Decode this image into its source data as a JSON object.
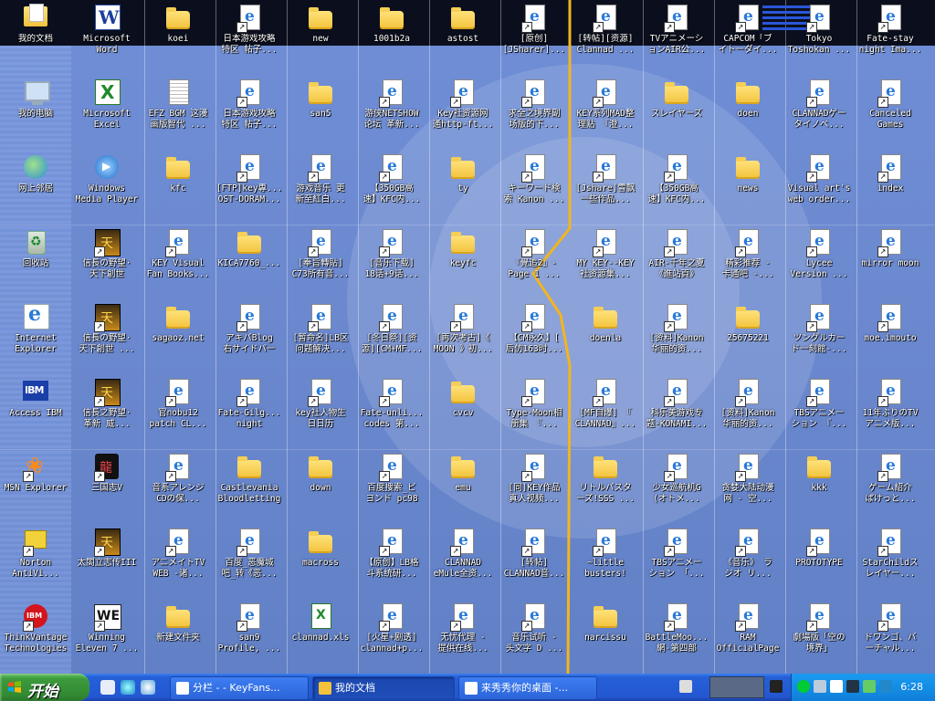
{
  "colors": {
    "desktop": "#6c89cf",
    "taskbar": "#2457d2",
    "start": "#3c9a3c"
  },
  "icons": [
    {
      "label": "我的文档",
      "icon": "my-documents-icon",
      "shape": "mydocs"
    },
    {
      "label": "我的电脑",
      "icon": "my-computer-icon",
      "shape": "pc"
    },
    {
      "label": "网上邻居",
      "icon": "network-places-icon",
      "shape": "net"
    },
    {
      "label": "回收站",
      "icon": "recycle-bin-icon",
      "shape": "bin"
    },
    {
      "label": "Internet\nExplorer",
      "icon": "internet-explorer-icon",
      "shape": "ie"
    },
    {
      "label": "Access IBM",
      "icon": "ibm-icon",
      "shape": "ibm"
    },
    {
      "label": "MSN Explorer",
      "icon": "msn-butterfly-icon",
      "shape": "msn"
    },
    {
      "label": "Norton\nAntiVi...",
      "icon": "norton-icon",
      "shape": "norton"
    },
    {
      "label": "ThinkVantage\nTechnologies",
      "icon": "thinkvantage-icon",
      "shape": "tvt"
    },
    {
      "label": "Microsoft\nWord",
      "icon": "word-icon",
      "shape": "word"
    },
    {
      "label": "Microsoft\nExcel",
      "icon": "excel-icon",
      "shape": "excel"
    },
    {
      "label": "Windows\nMedia Player",
      "icon": "media-player-icon",
      "shape": "wmp"
    },
    {
      "label": "信長の野望·\n天下創世",
      "icon": "game-icon",
      "shape": "game"
    },
    {
      "label": "信長の野望·\n天下創世 ...",
      "icon": "game-icon",
      "shape": "game"
    },
    {
      "label": "信長之野望·\n革新 威...",
      "icon": "game-icon",
      "shape": "game"
    },
    {
      "label": "三国志V",
      "icon": "dragon-icon",
      "shape": "dragon"
    },
    {
      "label": "太閤立志传III",
      "icon": "game-icon",
      "shape": "game"
    },
    {
      "label": "Winning\nEleven 7 ...",
      "icon": "we-icon",
      "shape": "we"
    },
    {
      "label": "koei",
      "icon": "folder-icon",
      "shape": "folder"
    },
    {
      "label": "EFZ BGM 这漫\n画版智代 ...",
      "icon": "document-icon",
      "shape": "doc"
    },
    {
      "label": "kfc",
      "icon": "folder-icon",
      "shape": "folder"
    },
    {
      "label": "KEY Visual\nFan Books...",
      "icon": "web-shortcut-icon",
      "shape": "url"
    },
    {
      "label": "sagaoz.net",
      "icon": "folder-icon",
      "shape": "folder"
    },
    {
      "label": "官nobu12\npatch CL...",
      "icon": "web-shortcut-icon",
      "shape": "url"
    },
    {
      "label": "音系アレンジ\nCDの保...",
      "icon": "web-shortcut-icon",
      "shape": "url"
    },
    {
      "label": "アニメイトTV\nWEB -诸...",
      "icon": "web-shortcut-icon",
      "shape": "url"
    },
    {
      "label": "新建文件夹",
      "icon": "folder-icon",
      "shape": "folder"
    },
    {
      "label": "日本游戏攻略\n特区 帖子...",
      "icon": "web-shortcut-icon",
      "shape": "url"
    },
    {
      "label": "日本游戏攻略\n特区 帖子...",
      "icon": "web-shortcut-icon",
      "shape": "url"
    },
    {
      "label": "[FTP]key專...\nOST-DORAM...",
      "icon": "web-shortcut-icon",
      "shape": "url"
    },
    {
      "label": "KICA7760_...",
      "icon": "folder-icon",
      "shape": "folder"
    },
    {
      "label": "アキバBlog\n右サイドバー",
      "icon": "web-shortcut-icon",
      "shape": "url"
    },
    {
      "label": "Fate-Gilg...\nnight",
      "icon": "web-shortcut-icon",
      "shape": "url"
    },
    {
      "label": "Castlevania\nBloodletting",
      "icon": "folder-icon",
      "shape": "folder"
    },
    {
      "label": "百度_恶魔城\n吧_转《恶...",
      "icon": "web-shortcut-icon",
      "shape": "url"
    },
    {
      "label": "san9\nProfile, ...",
      "icon": "web-shortcut-icon",
      "shape": "url"
    },
    {
      "label": "new",
      "icon": "folder-icon",
      "shape": "folder"
    },
    {
      "label": "san5",
      "icon": "folder-icon",
      "shape": "folder"
    },
    {
      "label": "游戏音乐 更\n新至紅白...",
      "icon": "web-shortcut-icon",
      "shape": "url"
    },
    {
      "label": "[奉旨轉貼]\nC73所有音...",
      "icon": "web-shortcut-icon",
      "shape": "url"
    },
    {
      "label": "[暂命名]LB区\n问题解决...",
      "icon": "web-shortcut-icon",
      "shape": "url"
    },
    {
      "label": "key社人物生\n日日历",
      "icon": "web-shortcut-icon",
      "shape": "url"
    },
    {
      "label": "down",
      "icon": "folder-icon",
      "shape": "folder"
    },
    {
      "label": "macross",
      "icon": "folder-icon",
      "shape": "folder"
    },
    {
      "label": "clannad.xls",
      "icon": "excel-file-icon",
      "shape": "xls"
    },
    {
      "label": "1001b2a",
      "icon": "folder-icon",
      "shape": "folder"
    },
    {
      "label": "游侠NETSHOW\n论坛 革新...",
      "icon": "web-shortcut-icon",
      "shape": "url"
    },
    {
      "label": "【350GB高\n速】KFC内...",
      "icon": "web-shortcut-icon",
      "shape": "url"
    },
    {
      "label": "[音乐下载]\n18话+9话...",
      "icon": "web-shortcut-icon",
      "shape": "url"
    },
    {
      "label": "[冬日祭][资\n源][CM+MF...",
      "icon": "web-shortcut-icon",
      "shape": "url"
    },
    {
      "label": "Fate-unli...\ncodes 第...",
      "icon": "web-shortcut-icon",
      "shape": "url"
    },
    {
      "label": "百度搜索_ビ\nヨンド pc98",
      "icon": "web-shortcut-icon",
      "shape": "url"
    },
    {
      "label": "【原创】LB格\n斗系统研...",
      "icon": "web-shortcut-icon",
      "shape": "url"
    },
    {
      "label": "[火星+剧透]\nclannad+p...",
      "icon": "web-shortcut-icon",
      "shape": "url"
    },
    {
      "label": "astost",
      "icon": "folder-icon",
      "shape": "folder"
    },
    {
      "label": "Key社资源网\n通http-ft...",
      "icon": "web-shortcut-icon",
      "shape": "url"
    },
    {
      "label": "ty",
      "icon": "folder-icon",
      "shape": "folder"
    },
    {
      "label": "keyfc",
      "icon": "folder-icon",
      "shape": "folder"
    },
    {
      "label": "[再次考古]《\nMOON 》初...",
      "icon": "web-shortcut-icon",
      "shape": "url"
    },
    {
      "label": "cvcv",
      "icon": "folder-icon",
      "shape": "folder"
    },
    {
      "label": "emu",
      "icon": "folder-icon",
      "shape": "folder"
    },
    {
      "label": "CLANNAD\neMule全资...",
      "icon": "web-shortcut-icon",
      "shape": "url"
    },
    {
      "label": "无忧代理 -\n提供在线...",
      "icon": "web-shortcut-icon",
      "shape": "url"
    },
    {
      "label": "[原创]\n[JSharer]...",
      "icon": "web-shortcut-icon",
      "shape": "url"
    },
    {
      "label": "求全之境界副\n场版的下...",
      "icon": "web-shortcut-icon",
      "shape": "url"
    },
    {
      "label": "キーワード検\n索 Kanon ...",
      "icon": "web-shortcut-icon",
      "shape": "url"
    },
    {
      "label": "『覺追2』-\nPage 1 ...",
      "icon": "web-shortcut-icon",
      "shape": "url"
    },
    {
      "label": "【CM永久】[\n后仿163时...",
      "icon": "web-shortcut-icon",
      "shape": "url"
    },
    {
      "label": "Type-Moon相\n册集 『...",
      "icon": "web-shortcut-icon",
      "shape": "url"
    },
    {
      "label": "[同]KEY作品\n真人视频...",
      "icon": "web-shortcut-icon",
      "shape": "url"
    },
    {
      "label": "[转帖]\nCLANNAD音...",
      "icon": "web-shortcut-icon",
      "shape": "url"
    },
    {
      "label": "音乐试听 -\n头文字 D ...",
      "icon": "web-shortcut-icon",
      "shape": "url"
    },
    {
      "label": "[转帖][资源]\nClannad ...",
      "icon": "web-shortcut-icon",
      "shape": "url"
    },
    {
      "label": "KEY系列MAD整\n理贴 『澄...",
      "icon": "web-shortcut-icon",
      "shape": "url"
    },
    {
      "label": "[Jshare]雪飘\n一些作品...",
      "icon": "web-shortcut-icon",
      "shape": "url"
    },
    {
      "label": "MY KEY--KEY\n社资源集...",
      "icon": "web-shortcut-icon",
      "shape": "url"
    },
    {
      "label": "doenla",
      "icon": "folder-icon",
      "shape": "folder"
    },
    {
      "label": "[MF自爆] 『\nCLANNAD』...",
      "icon": "web-shortcut-icon",
      "shape": "url"
    },
    {
      "label": "リトルバスタ\nーズ!SSS ...",
      "icon": "folder-icon",
      "shape": "folder"
    },
    {
      "label": "~little\nbusters!",
      "icon": "web-shortcut-icon",
      "shape": "url"
    },
    {
      "label": "narcissu",
      "icon": "folder-icon",
      "shape": "folder"
    },
    {
      "label": "TVアニメーシ\nョンAIR公...",
      "icon": "web-shortcut-icon",
      "shape": "url"
    },
    {
      "label": "スレイヤーズ",
      "icon": "folder-icon",
      "shape": "folder"
    },
    {
      "label": "【350GB高\n速】KFC内...",
      "icon": "web-shortcut-icon",
      "shape": "url"
    },
    {
      "label": "AIR-千年之夏\n《進站頁》",
      "icon": "web-shortcut-icon",
      "shape": "url"
    },
    {
      "label": "[资料]Kanon\n华丽的资...",
      "icon": "web-shortcut-icon",
      "shape": "url"
    },
    {
      "label": "科乐美游戏专\n题-KONAMI...",
      "icon": "web-shortcut-icon",
      "shape": "url"
    },
    {
      "label": "少女巡航机G\n(オトメ...",
      "icon": "web-shortcut-icon",
      "shape": "url"
    },
    {
      "label": "TBSアニメー\nション 「...",
      "icon": "web-shortcut-icon",
      "shape": "url"
    },
    {
      "label": "BattleMoo...\n網-第四部",
      "icon": "web-shortcut-icon",
      "shape": "url"
    },
    {
      "label": "CAPCOM「ブ\nイトーダイ...",
      "icon": "web-shortcut-icon",
      "shape": "url"
    },
    {
      "label": "doen",
      "icon": "folder-icon",
      "shape": "folder"
    },
    {
      "label": "news",
      "icon": "folder-icon",
      "shape": "folder"
    },
    {
      "label": "精彩推荐 -\n卡通吧 -...",
      "icon": "web-shortcut-icon",
      "shape": "url"
    },
    {
      "label": "25675221",
      "icon": "folder-icon",
      "shape": "folder"
    },
    {
      "label": "[资料]Kanon\n华丽的资...",
      "icon": "web-shortcut-icon",
      "shape": "url"
    },
    {
      "label": "贪婪大陆动漫\n网 - 空...",
      "icon": "web-shortcut-icon",
      "shape": "url"
    },
    {
      "label": "《音乐》 ラ\nジオ リ...",
      "icon": "web-shortcut-icon",
      "shape": "url"
    },
    {
      "label": "RAM\nOfficialPage",
      "icon": "web-shortcut-icon",
      "shape": "url"
    },
    {
      "label": "Tokyo\nToshokan ...",
      "icon": "web-shortcut-icon",
      "shape": "url"
    },
    {
      "label": "CLANNADゲー\nタイノベ...",
      "icon": "web-shortcut-icon",
      "shape": "url"
    },
    {
      "label": "Visual art's\nweb order...",
      "icon": "web-shortcut-icon",
      "shape": "url"
    },
    {
      "label": "Lycee\nVersion ...",
      "icon": "web-shortcut-icon",
      "shape": "url"
    },
    {
      "label": "ツングルカー\nド一刻館-...",
      "icon": "web-shortcut-icon",
      "shape": "url"
    },
    {
      "label": "TBSアニメー\nション 『...",
      "icon": "web-shortcut-icon",
      "shape": "url"
    },
    {
      "label": "kkk",
      "icon": "folder-icon",
      "shape": "folder"
    },
    {
      "label": "PROTOTYPE",
      "icon": "web-shortcut-icon",
      "shape": "url"
    },
    {
      "label": "劇場版「空の\n境界」",
      "icon": "web-shortcut-icon",
      "shape": "url"
    },
    {
      "label": "Fate-stay\nnight Ima...",
      "icon": "web-shortcut-icon",
      "shape": "url"
    },
    {
      "label": "Canceled\nGames",
      "icon": "web-shortcut-icon",
      "shape": "url"
    },
    {
      "label": "index",
      "icon": "web-shortcut-icon",
      "shape": "url"
    },
    {
      "label": "mirror moon",
      "icon": "web-shortcut-icon",
      "shape": "url"
    },
    {
      "label": "moe.imouto",
      "icon": "web-shortcut-icon",
      "shape": "url"
    },
    {
      "label": "11年ぶりのTV\nアニメ版...",
      "icon": "web-shortcut-icon",
      "shape": "url"
    },
    {
      "label": "ゲーム紹介\nぱけっと...",
      "icon": "web-shortcut-icon",
      "shape": "url"
    },
    {
      "label": "StarChildス\nレイヤー...",
      "icon": "web-shortcut-icon",
      "shape": "url"
    },
    {
      "label": "ドワンゴ、バ\nーチャル...",
      "icon": "web-shortcut-icon",
      "shape": "url"
    }
  ],
  "taskbar": {
    "start_label": "开始",
    "tasks": [
      {
        "label": "分栏 - - KeyFans...",
        "active": false
      },
      {
        "label": "我的文档",
        "active": true
      },
      {
        "label": "来秀秀你的桌面 -...",
        "active": false
      }
    ],
    "clock": "6:28"
  }
}
